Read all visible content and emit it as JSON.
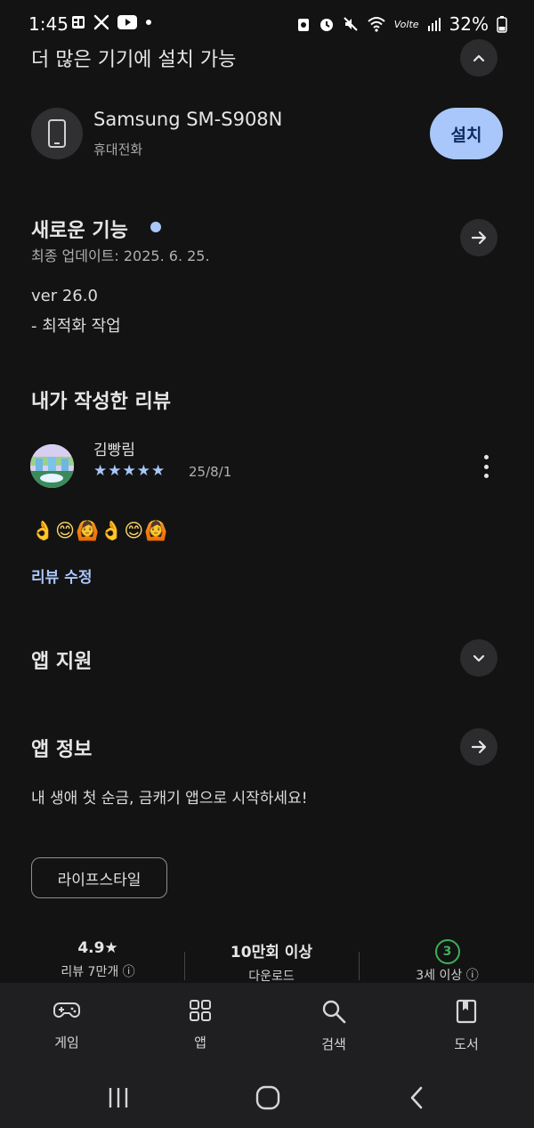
{
  "status_bar": {
    "time": "1:45",
    "battery": "32%",
    "left_icons": [
      "gallery-icon",
      "tools-icon",
      "youtube-icon",
      "dot-icon"
    ],
    "right_icons": [
      "recycle-icon",
      "alarm-icon",
      "mute-icon",
      "wifi-icon",
      "volte-icon",
      "signal-icon",
      "battery-icon"
    ],
    "volte_label": "Volte"
  },
  "devices_section": {
    "title": "더 많은 기기에 설치 가능",
    "device_name": "Samsung SM-S908N",
    "device_type": "휴대전화",
    "install_label": "설치"
  },
  "whats_new": {
    "title": "새로운 기능",
    "last_updated": "최종 업데이트: 2025. 6. 25.",
    "version": "ver 26.0",
    "notes": "- 최적화 작업",
    "accent": "#a9c7fa"
  },
  "my_review": {
    "title": "내가 작성한 리뷰",
    "reviewer": "김빵림",
    "rating": 5,
    "rating_max": 5,
    "date": "25/8/1",
    "text": "👌😊🙆👌😊🙆",
    "edit_label": "리뷰 수정"
  },
  "app_support": {
    "title": "앱 지원"
  },
  "app_info": {
    "title": "앱 정보",
    "description": "내 생애 첫 순금, 금캐기 앱으로 시작하세요!",
    "category_chip": "라이프스타일"
  },
  "stats": {
    "rating_value": "4.9★",
    "rating_label": "리뷰 7만개 ⓘ",
    "downloads_value": "10만회 이상",
    "downloads_label": "다운로드",
    "age_value": "3",
    "age_label": "3세 이상 ⓘ"
  },
  "bottom_nav": {
    "items": [
      {
        "label": "게임",
        "icon": "gamepad-icon"
      },
      {
        "label": "앱",
        "icon": "apps-grid-icon"
      },
      {
        "label": "검색",
        "icon": "search-icon"
      },
      {
        "label": "도서",
        "icon": "book-icon"
      }
    ]
  },
  "system_nav": {
    "icons": [
      "recents-icon",
      "home-icon",
      "back-icon"
    ]
  },
  "colors": {
    "background": "#131313",
    "install_button": "#a9c7fa",
    "link": "#a9c7fa",
    "age_badge": "#3fae58"
  }
}
